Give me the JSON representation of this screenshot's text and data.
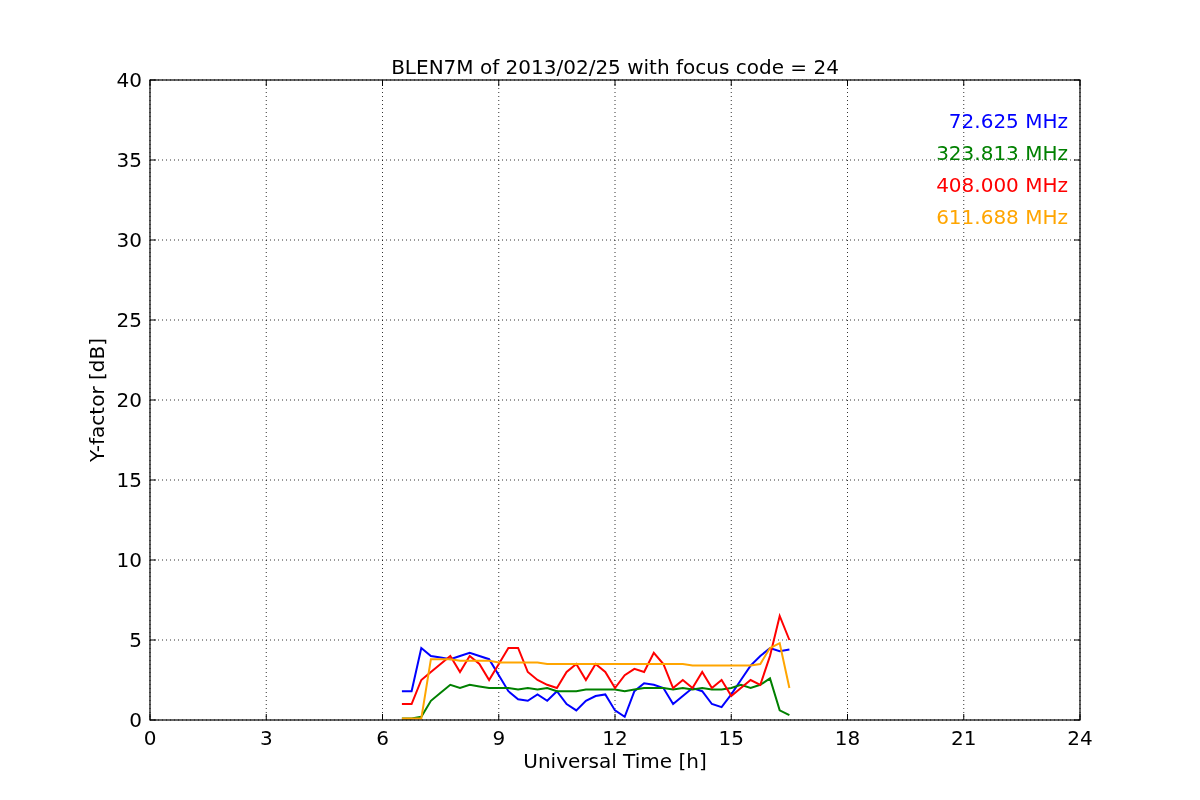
{
  "chart_data": {
    "type": "line",
    "title": "BLEN7M of 2013/02/25 with focus code = 24",
    "xlabel": "Universal Time [h]",
    "ylabel": "Y-factor [dB]",
    "x": [
      6.5,
      6.75,
      7,
      7.25,
      7.5,
      7.75,
      8,
      8.25,
      8.5,
      8.75,
      9,
      9.25,
      9.5,
      9.75,
      10,
      10.25,
      10.5,
      10.75,
      11,
      11.25,
      11.5,
      11.75,
      12,
      12.25,
      12.5,
      12.75,
      13,
      13.25,
      13.5,
      13.75,
      14,
      14.25,
      14.5,
      14.75,
      15,
      15.25,
      15.5,
      15.75,
      16,
      16.25,
      16.5
    ],
    "series": [
      {
        "name": "72.625 MHz",
        "color": "#0000ff",
        "values": [
          1.8,
          1.8,
          4.5,
          4.0,
          3.9,
          3.8,
          4.0,
          4.2,
          4.0,
          3.8,
          2.8,
          1.8,
          1.3,
          1.2,
          1.6,
          1.2,
          1.8,
          1.0,
          0.6,
          1.2,
          1.5,
          1.6,
          0.6,
          0.2,
          1.8,
          2.3,
          2.2,
          2.0,
          1.0,
          1.5,
          2.0,
          1.8,
          1.0,
          0.8,
          1.6,
          2.5,
          3.4,
          4.0,
          4.5,
          4.3,
          4.4
        ]
      },
      {
        "name": "323.813 MHz",
        "color": "#008000",
        "values": [
          0.1,
          0.1,
          0.2,
          1.2,
          1.7,
          2.2,
          2.0,
          2.2,
          2.1,
          2.0,
          2.0,
          2.0,
          1.9,
          2.0,
          1.9,
          2.0,
          1.8,
          1.8,
          1.8,
          1.9,
          1.9,
          1.9,
          1.9,
          1.8,
          1.9,
          2.0,
          2.0,
          2.0,
          1.9,
          2.0,
          1.9,
          2.0,
          1.9,
          1.9,
          2.0,
          2.2,
          2.0,
          2.2,
          2.6,
          0.6,
          0.3
        ]
      },
      {
        "name": "408.000 MHz",
        "color": "#ff0000",
        "values": [
          1.0,
          1.0,
          2.5,
          3.0,
          3.5,
          4.0,
          3.0,
          4.0,
          3.5,
          2.5,
          3.5,
          4.5,
          4.5,
          3.0,
          2.5,
          2.2,
          2.0,
          3.0,
          3.5,
          2.5,
          3.5,
          3.0,
          2.0,
          2.8,
          3.2,
          3.0,
          4.2,
          3.5,
          2.0,
          2.5,
          2.0,
          3.0,
          2.0,
          2.5,
          1.5,
          2.0,
          2.5,
          2.2,
          4.0,
          6.5,
          5.0
        ]
      },
      {
        "name": "611.688 MHz",
        "color": "#ffa500",
        "values": [
          0.1,
          0.1,
          0.1,
          3.8,
          3.8,
          3.8,
          3.7,
          3.7,
          3.7,
          3.7,
          3.6,
          3.6,
          3.6,
          3.6,
          3.6,
          3.5,
          3.5,
          3.5,
          3.5,
          3.5,
          3.5,
          3.5,
          3.5,
          3.5,
          3.5,
          3.5,
          3.5,
          3.5,
          3.5,
          3.5,
          3.4,
          3.4,
          3.4,
          3.4,
          3.4,
          3.4,
          3.4,
          3.5,
          4.5,
          4.8,
          2.0
        ]
      }
    ],
    "xlim": [
      0,
      24
    ],
    "ylim": [
      0,
      40
    ],
    "xticks": [
      0,
      3,
      6,
      9,
      12,
      15,
      18,
      21,
      24
    ],
    "yticks": [
      0,
      5,
      10,
      15,
      20,
      25,
      30,
      35,
      40
    ],
    "grid": true
  }
}
